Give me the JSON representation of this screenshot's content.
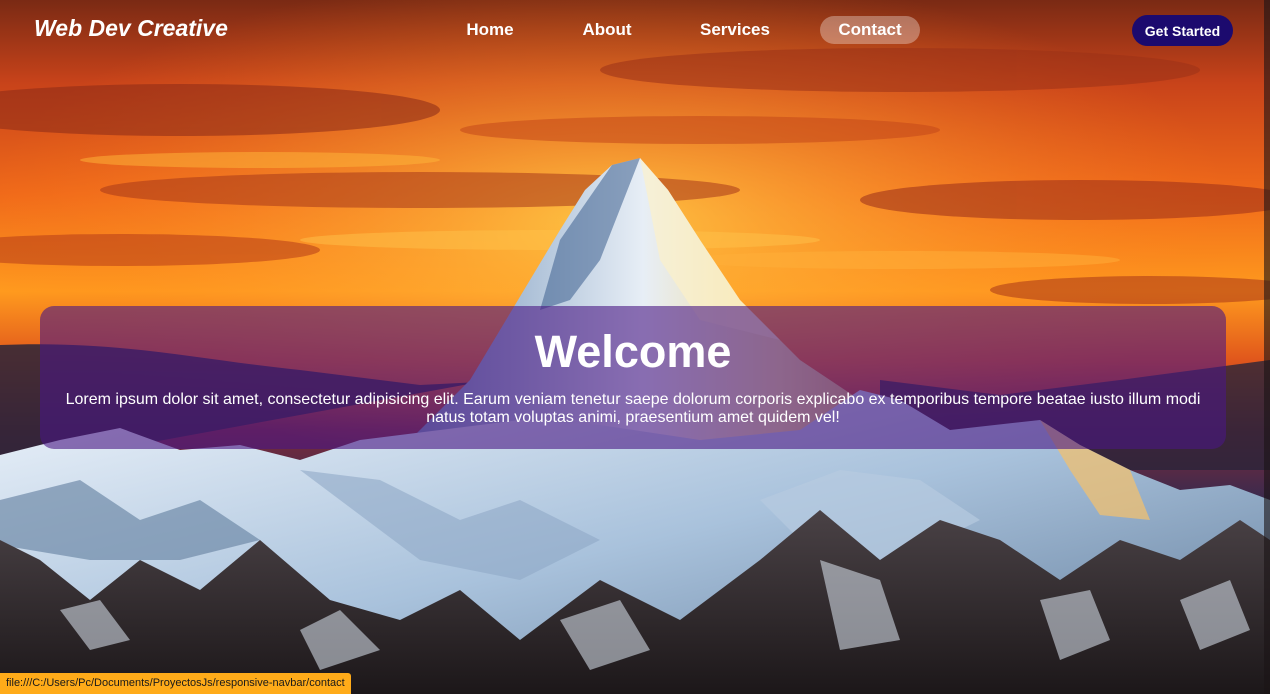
{
  "navbar": {
    "brand": "Web Dev Creative",
    "links": [
      {
        "label": "Home",
        "active": false
      },
      {
        "label": "About",
        "active": false
      },
      {
        "label": "Services",
        "active": false
      },
      {
        "label": "Contact",
        "active": true
      }
    ],
    "cta_label": "Get Started"
  },
  "hero": {
    "title": "Welcome",
    "text": "Lorem ipsum dolor sit amet, consectetur adipisicing elit. Earum veniam tenetur saepe dolorum corporis explicabo ex temporibus tempore beatae iusto illum modi natus totam voluptas animi, praesentium amet quidem vel!"
  },
  "status_bar": {
    "url": "file:///C:/Users/Pc/Documents/ProyectosJs/responsive-navbar/contact"
  },
  "colors": {
    "cta_background": "#1c0a6e",
    "hero_card_background": "#4a1884",
    "status_bar_background": "#ffab19",
    "active_link_highlight": "#ffffff"
  },
  "background_image": "mountain-sunset-photo"
}
